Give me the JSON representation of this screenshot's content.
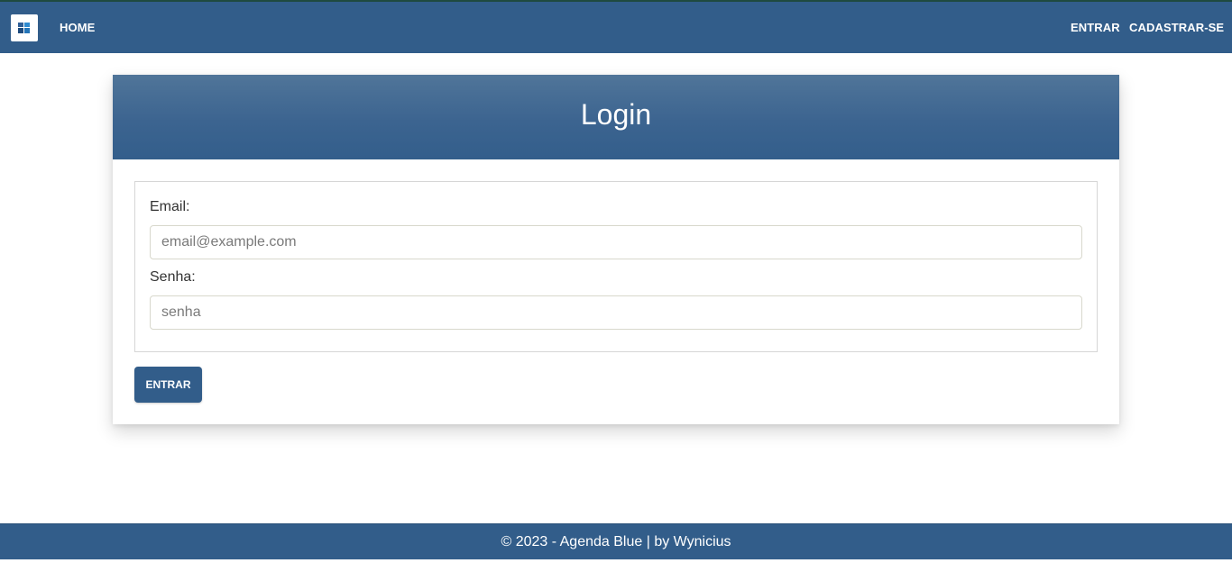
{
  "navbar": {
    "logo_icon": "grid-logo-icon",
    "home_label": "HOME",
    "login_label": "ENTRAR",
    "signup_label": "CADASTRAR-SE",
    "background_color": "#325d8a"
  },
  "login_card": {
    "title": "Login",
    "email": {
      "label": "Email:",
      "placeholder": "email@example.com",
      "value": ""
    },
    "password": {
      "label": "Senha:",
      "placeholder": "senha",
      "value": ""
    },
    "submit_label": "ENTRAR"
  },
  "footer": {
    "text": "© 2023 - Agenda Blue | by Wynicius"
  },
  "colors": {
    "primary": "#325d8a",
    "header_gradient_top": "#507599",
    "white": "#ffffff"
  }
}
